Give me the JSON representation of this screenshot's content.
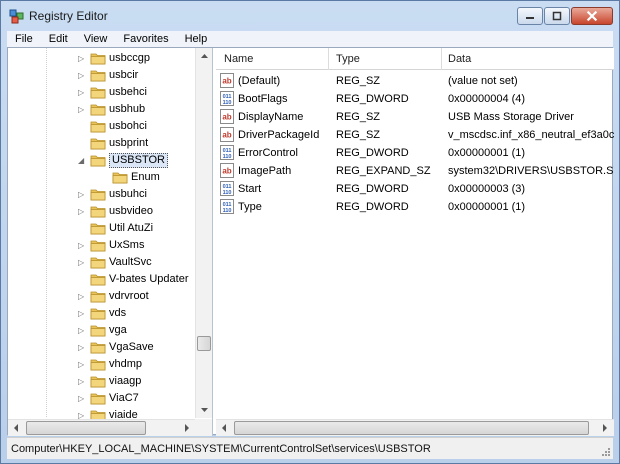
{
  "window": {
    "title": "Registry Editor",
    "app_icon": "registry-editor-icon"
  },
  "menu": [
    "File",
    "Edit",
    "View",
    "Favorites",
    "Help"
  ],
  "tree": {
    "items": [
      {
        "label": "usbccgp",
        "expandable": true
      },
      {
        "label": "usbcir",
        "expandable": true
      },
      {
        "label": "usbehci",
        "expandable": true
      },
      {
        "label": "usbhub",
        "expandable": true
      },
      {
        "label": "usbohci",
        "expandable": false
      },
      {
        "label": "usbprint",
        "expandable": false
      },
      {
        "label": "USBSTOR",
        "expandable": true,
        "expanded": true,
        "selected": true
      },
      {
        "label": "Enum",
        "expandable": false,
        "child": true
      },
      {
        "label": "usbuhci",
        "expandable": true
      },
      {
        "label": "usbvideo",
        "expandable": true
      },
      {
        "label": "Util AtuZi",
        "expandable": false
      },
      {
        "label": "UxSms",
        "expandable": true
      },
      {
        "label": "VaultSvc",
        "expandable": true
      },
      {
        "label": "V-bates Updater",
        "expandable": false
      },
      {
        "label": "vdrvroot",
        "expandable": true
      },
      {
        "label": "vds",
        "expandable": true
      },
      {
        "label": "vga",
        "expandable": true
      },
      {
        "label": "VgaSave",
        "expandable": true
      },
      {
        "label": "vhdmp",
        "expandable": true
      },
      {
        "label": "viaagp",
        "expandable": true
      },
      {
        "label": "ViaC7",
        "expandable": true
      },
      {
        "label": "viaide",
        "expandable": true
      }
    ]
  },
  "list": {
    "columns": [
      "Name",
      "Type",
      "Data"
    ],
    "rows": [
      {
        "icon": "string-value-icon",
        "name": "(Default)",
        "type": "REG_SZ",
        "data": "(value not set)"
      },
      {
        "icon": "binary-value-icon",
        "name": "BootFlags",
        "type": "REG_DWORD",
        "data": "0x00000004 (4)"
      },
      {
        "icon": "string-value-icon",
        "name": "DisplayName",
        "type": "REG_SZ",
        "data": "USB Mass Storage Driver"
      },
      {
        "icon": "string-value-icon",
        "name": "DriverPackageId",
        "type": "REG_SZ",
        "data": "v_mscdsc.inf_x86_neutral_ef3a0c3"
      },
      {
        "icon": "binary-value-icon",
        "name": "ErrorControl",
        "type": "REG_DWORD",
        "data": "0x00000001 (1)"
      },
      {
        "icon": "string-value-icon",
        "name": "ImagePath",
        "type": "REG_EXPAND_SZ",
        "data": "system32\\DRIVERS\\USBSTOR.SYS"
      },
      {
        "icon": "binary-value-icon",
        "name": "Start",
        "type": "REG_DWORD",
        "data": "0x00000003 (3)"
      },
      {
        "icon": "binary-value-icon",
        "name": "Type",
        "type": "REG_DWORD",
        "data": "0x00000001 (1)"
      }
    ]
  },
  "status": {
    "path": "Computer\\HKEY_LOCAL_MACHINE\\SYSTEM\\CurrentControlSet\\services\\USBSTOR"
  },
  "colors": {
    "folder": "#e8c35a",
    "selection": "#dbe7f6",
    "string_icon_red": "#c0392b",
    "binary_icon_blue": "#2d5fb8"
  }
}
